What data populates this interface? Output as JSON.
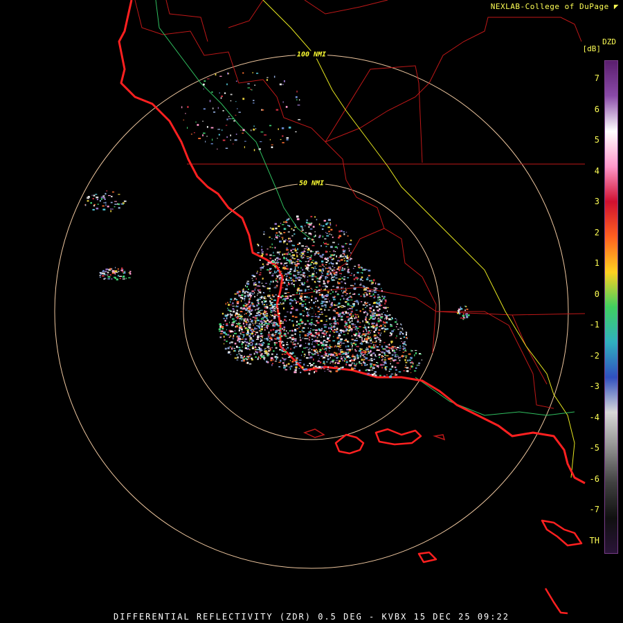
{
  "header": {
    "credit": "NEXLAB-College of DuPage",
    "logo_icon": "nexlab-logo-icon"
  },
  "footer": {
    "caption": "DIFFERENTIAL REFLECTIVITY (ZDR) 0.5 DEG - KVBX 15 DEC 25 09:22"
  },
  "map": {
    "rings": [
      {
        "label": "100 NMI",
        "range_nmi": 100
      },
      {
        "label": "50 NMI",
        "range_nmi": 50
      }
    ],
    "colors": {
      "coastline": "#ff2020",
      "borders": "#c01818",
      "highway": "#e8e820",
      "river": "#30c060",
      "ring": "#f0c8a0"
    }
  },
  "legend": {
    "title": "DZD",
    "unit": "[dB]",
    "ticks": [
      "7",
      "6",
      "5",
      "4",
      "3",
      "2",
      "1",
      "0",
      "-1",
      "-2",
      "-3",
      "-4",
      "-5",
      "-6",
      "-7",
      "TH"
    ],
    "colors": [
      "#5a1e6e",
      "#8a4aa8",
      "#ffffff",
      "#ff99cc",
      "#d01030",
      "#ff6020",
      "#ffd020",
      "#40d060",
      "#30b0c0",
      "#3050c0",
      "#d8d8d8",
      "#909090",
      "#404040",
      "#101010",
      "#2a1438"
    ]
  }
}
